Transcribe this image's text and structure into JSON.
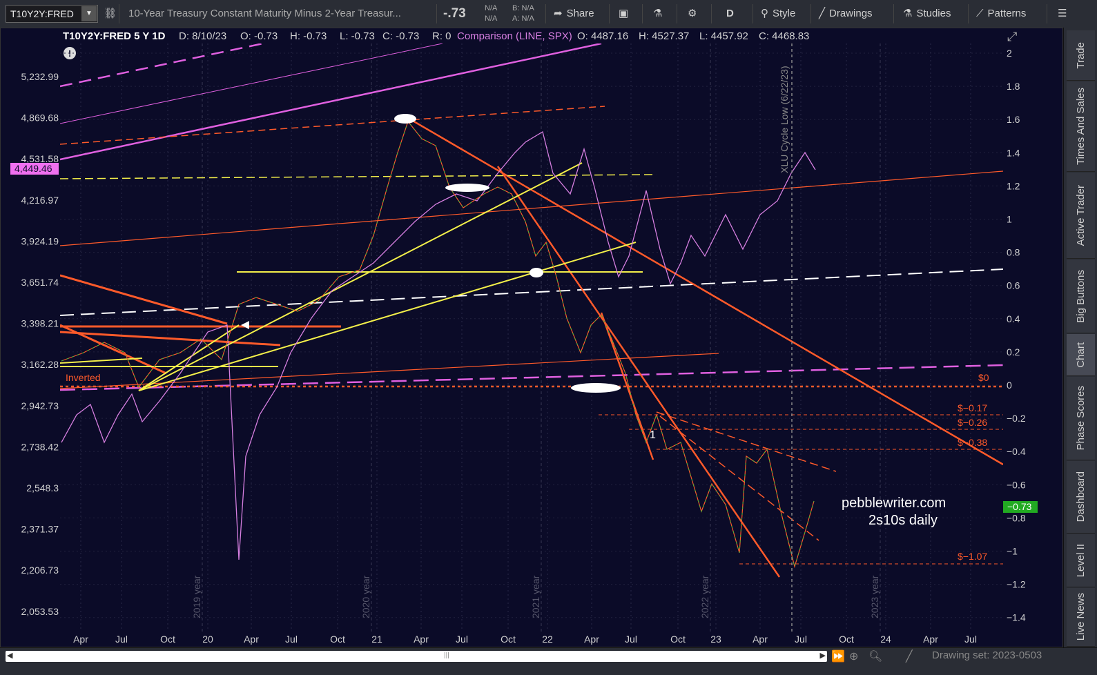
{
  "toolbar": {
    "symbol": "T10Y2Y:FRED",
    "description": "10-Year Treasury Constant Maturity Minus 2-Year Treasur...",
    "last_value": "-.73",
    "bid_label": "N/A",
    "ask_label": "N/A",
    "b_label": "B: N/A",
    "a_label": "A: N/A",
    "share_label": "Share",
    "period_label": "D",
    "style_label": "Style",
    "drawings_label": "Drawings",
    "studies_label": "Studies",
    "patterns_label": "Patterns"
  },
  "header": {
    "symbol_period": "T10Y2Y:FRED 5 Y 1D",
    "date": "D: 8/10/23",
    "open": "O: -0.73",
    "high": "H: -0.73",
    "low": "L: -0.73",
    "close": "C: -0.73",
    "range": "R: 0",
    "comparison": "Comparison (LINE, SPX)",
    "cmp_open": "O: 4487.16",
    "cmp_high": "H: 4527.37",
    "cmp_low": "L: 4457.92",
    "cmp_close": "C: 4468.83"
  },
  "left_axis": {
    "ticks": [
      "5,232.99",
      "4,869.68",
      "4,531.58",
      "4,216.97",
      "3,924.19",
      "3,651.74",
      "3,398.21",
      "3,162.28",
      "2,942.73",
      "2,738.42",
      "2,548.3",
      "2,371.37",
      "2,206.73",
      "2,053.53"
    ],
    "price_tag": "4,449.46"
  },
  "right_axis": {
    "ticks": [
      "2",
      "1.8",
      "1.6",
      "1.4",
      "1.2",
      "1",
      "0.8",
      "0.6",
      "0.4",
      "0.2",
      "0",
      "−0.2",
      "−0.4",
      "−0.6",
      "−0.8",
      "−1",
      "−1.2",
      "−1.4"
    ],
    "price_tag": "−0.73"
  },
  "x_axis": {
    "ticks": [
      "Apr",
      "Jul",
      "Oct",
      "20",
      "Apr",
      "Jul",
      "Oct",
      "21",
      "Apr",
      "Jul",
      "Oct",
      "22",
      "Apr",
      "Jul",
      "Oct",
      "23",
      "Apr",
      "Jul",
      "Oct",
      "24",
      "Apr",
      "Jul"
    ],
    "year_labels": [
      "2019 year",
      "2020 year",
      "2021 year",
      "2022 year",
      "2023 year"
    ]
  },
  "annotations": {
    "inverted": "Inverted",
    "zero": "$0",
    "level_017": "$−0.17",
    "level_026": "$−0.26",
    "level_038": "$−0.38",
    "level_107": "$−1.07",
    "cycle_low": "XLU Cycle Low (6/22/23)",
    "wave_label": "1",
    "watermark_line1": "pebblewriter.com",
    "watermark_line2": "2s10s daily"
  },
  "sidebar": {
    "tabs": [
      "Trade",
      "Times And Sales",
      "Active Trader",
      "Big Buttons",
      "Chart",
      "Phase Scores",
      "Dashboard",
      "Level II",
      "Live News"
    ],
    "active": "Chart"
  },
  "bottom": {
    "drawing_set": "Drawing set: 2023-0503"
  },
  "colors": {
    "background": "#0b0b28",
    "spx_line": "#d67fe0",
    "trendline_orange": "#ff5a2a",
    "trendline_yellow": "#f4f04a",
    "trendline_magenta": "#e060e0",
    "positive_tag": "#22aa22"
  }
}
